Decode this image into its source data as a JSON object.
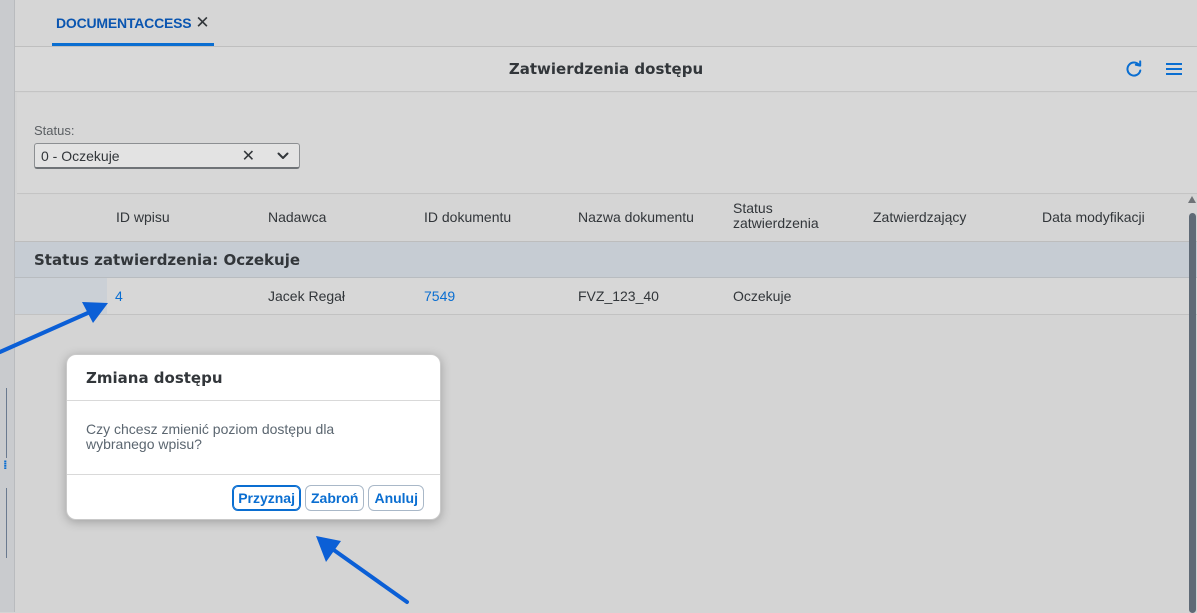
{
  "tabs": [
    {
      "label": "DOCUMENTACCESS",
      "close_glyph": "✕"
    }
  ],
  "header": {
    "title": "Zatwierdzenia dostępu",
    "refresh_icon": "refresh-icon",
    "menu_icon": "hamburger-menu-icon"
  },
  "filter": {
    "label": "Status:",
    "value": "0 - Oczekuje",
    "clear_glyph": "✕"
  },
  "table": {
    "columns": [
      "ID wpisu",
      "Nadawca",
      "ID dokumentu",
      "Nazwa dokumentu",
      "Status zatwierdzenia",
      "Zatwierdzający",
      "Data modyfikacji"
    ],
    "status_column_line1": "Status",
    "status_column_line2": "zatwierdzenia",
    "group_label": "Status zatwierdzenia: Oczekuje",
    "rows": [
      {
        "id": "4",
        "sender": "Jacek Regał",
        "document_id": "7549",
        "document_name": "FVZ_123_40",
        "status": "Oczekuje",
        "approver": "",
        "modified": ""
      }
    ]
  },
  "dialog": {
    "title": "Zmiana dostępu",
    "message": "Czy chcesz zmienić poziom dostępu dla wybranego wpisu?",
    "buttons": {
      "grant": "Przyznaj",
      "deny": "Zabroń",
      "cancel": "Anuluj"
    }
  },
  "colors": {
    "accent": "#0a6ed1",
    "annotation_arrow": "#0b5fd6",
    "group_row": "#c6ccd3"
  }
}
